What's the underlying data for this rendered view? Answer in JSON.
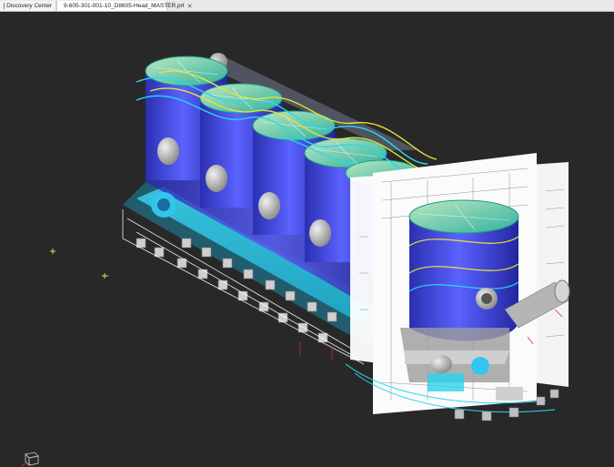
{
  "tabs": [
    {
      "label": "Discovery Center",
      "icon": "discovery-center-icon"
    },
    {
      "label": "9-605-301-001-10_D8605-Head_MASTER.prt",
      "icon": "part-file-icon"
    }
  ],
  "colors": {
    "viewport_bg": "#282828",
    "body_blue": "#3a3fd0",
    "cyan": "#27d9f2",
    "yellow": "#e8e23a",
    "drawing_paper": "#ffffff"
  }
}
